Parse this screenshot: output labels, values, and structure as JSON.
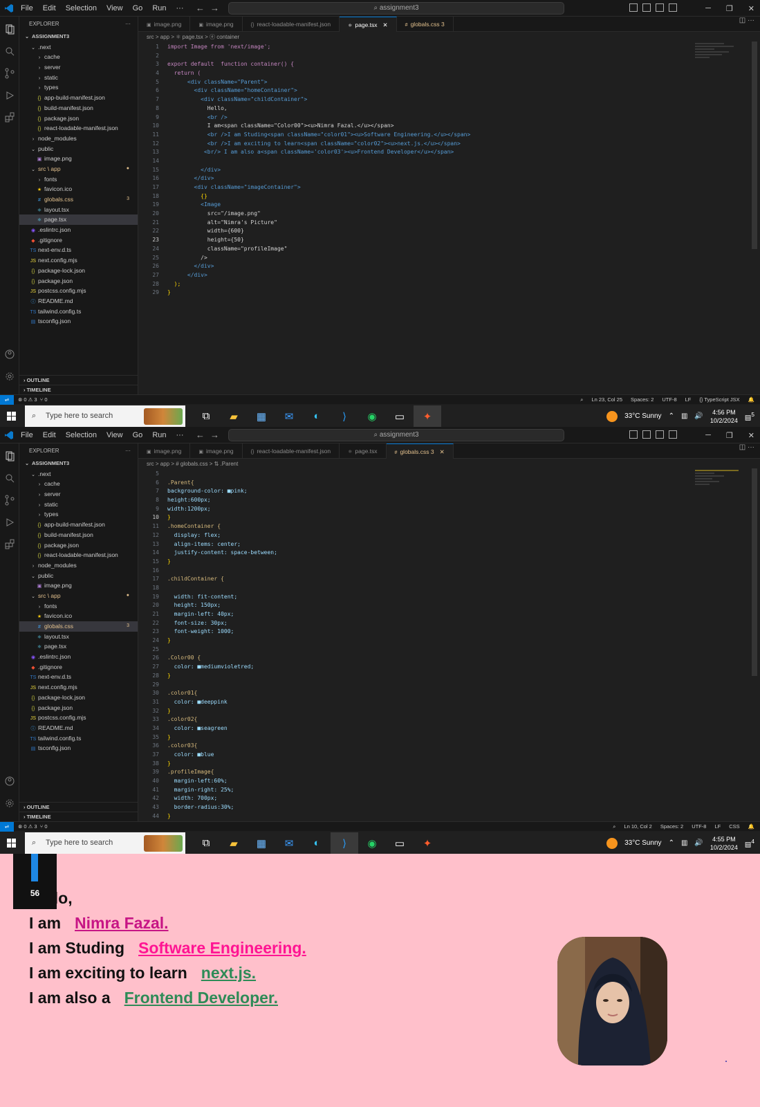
{
  "menu": [
    "File",
    "Edit",
    "Selection",
    "View",
    "Go",
    "Run",
    "···"
  ],
  "command_center": "assignment3",
  "explorer": {
    "title": "EXPLORER",
    "root": "ASSIGNMENT3",
    "items": [
      {
        "label": ".next",
        "glyph": "⌄",
        "depth": 1
      },
      {
        "label": "cache",
        "glyph": "›",
        "depth": 2
      },
      {
        "label": "server",
        "glyph": "›",
        "depth": 2
      },
      {
        "label": "static",
        "glyph": "›",
        "depth": 2
      },
      {
        "label": "types",
        "glyph": "›",
        "depth": 2
      },
      {
        "label": "app-build-manifest.json",
        "glyph": "{}",
        "depth": 2
      },
      {
        "label": "build-manifest.json",
        "glyph": "{}",
        "depth": 2
      },
      {
        "label": "package.json",
        "glyph": "{}",
        "depth": 2
      },
      {
        "label": "react-loadable-manifest.json",
        "glyph": "{}",
        "depth": 2
      },
      {
        "label": "node_modules",
        "glyph": "›",
        "depth": 1
      },
      {
        "label": "public",
        "glyph": "⌄",
        "depth": 1
      },
      {
        "label": "image.png",
        "glyph": "▣",
        "depth": 2
      },
      {
        "label": "src \\ app",
        "glyph": "⌄",
        "depth": 1
      },
      {
        "label": "fonts",
        "glyph": "›",
        "depth": 2
      },
      {
        "label": "favicon.ico",
        "glyph": "★",
        "depth": 2
      },
      {
        "label": "globals.css",
        "glyph": "#",
        "depth": 2
      },
      {
        "label": "layout.tsx",
        "glyph": "⚛",
        "depth": 2
      },
      {
        "label": "page.tsx",
        "glyph": "⚛",
        "depth": 2
      },
      {
        "label": ".eslintrc.json",
        "glyph": "◉",
        "depth": 1
      },
      {
        "label": ".gitignore",
        "glyph": "◆",
        "depth": 1
      },
      {
        "label": "next-env.d.ts",
        "glyph": "TS",
        "depth": 1
      },
      {
        "label": "next.config.mjs",
        "glyph": "JS",
        "depth": 1
      },
      {
        "label": "package-lock.json",
        "glyph": "{}",
        "depth": 1
      },
      {
        "label": "package.json",
        "glyph": "{}",
        "depth": 1
      },
      {
        "label": "postcss.config.mjs",
        "glyph": "JS",
        "depth": 1
      },
      {
        "label": "README.md",
        "glyph": "ⓘ",
        "depth": 1
      },
      {
        "label": "tailwind.config.ts",
        "glyph": "TS",
        "depth": 1
      },
      {
        "label": "tsconfig.json",
        "glyph": "▤",
        "depth": 1
      }
    ],
    "outline": "OUTLINE",
    "timeline": "TIMELINE"
  },
  "tabs": [
    "image.png",
    "image.png",
    "react-loadable-manifest.json",
    "page.tsx",
    "globals.css 3"
  ],
  "top": {
    "breadcrumb": "src > app > ⚛ page.tsx > ⓔ container",
    "cursor": "Ln 23, Col 25",
    "lang": "TypeScript JSX",
    "time": "4:56 PM",
    "date": "10/2/2024",
    "notif": "5",
    "code": [
      "import Image from 'next/image';",
      "",
      "export default  function container() {",
      "  return (",
      "      <div className=\"Parent\">",
      "        <div className=\"homeContainer\">",
      "          <div className=\"childContainer\">",
      "            Hello,",
      "            <br />",
      "            I am<span className=\"Color00\"><u>Nimra Fazal.</u></span>",
      "            <br />I am Studing<span className=\"color01\"><u>Software Engineering.</u></span>",
      "            <br />I am exciting to learn<span className=\"color02\"><u>next.js.</u></span>",
      "           <br/> I am also a<span className='color03'><u>Frontend Developer</u></span>",
      "",
      "          </div>",
      "        </div>",
      "        <div className=\"imageContainer\">",
      "          {}",
      "          <Image",
      "            src=\"/image.png\"",
      "            alt=\"Nimra's Picture\"",
      "            width={600}",
      "            height={50}",
      "            className=\"profileImage\"",
      "          />",
      "        </div>",
      "      </div>",
      "  );",
      "}"
    ]
  },
  "bottom": {
    "breadcrumb": "src > app > # globals.css > ⇅ .Parent",
    "cursor": "Ln 10, Col 2",
    "lang": "CSS",
    "time": "4:55 PM",
    "date": "10/2/2024",
    "notif": "4",
    "code": [
      "",
      ".Parent{",
      "background-color: ■pink;",
      "height:600px;",
      "width:1200px;",
      "}",
      ".homeContainer {",
      "  display: flex;",
      "  align-items: center;",
      "  justify-content: space-between;",
      "}",
      "",
      ".childContainer {",
      "",
      "  width: fit-content;",
      "  height: 150px;",
      "  margin-left: 40px;",
      "  font-size: 30px;",
      "  font-weight: 1000;",
      "}",
      "",
      ".Color00 {",
      "  color: ■mediumvioletred;",
      "}",
      "",
      ".color01{",
      "  color: ■deeppink",
      "}",
      ".color02{",
      "  color: ■seagreen",
      "}",
      ".color03{",
      "  color: ■blue",
      "}",
      ".profileImage{",
      "  margin-left:60%;",
      "  margin-right: 25%;",
      "  width: 700px;",
      "  border-radius:30%;",
      "}"
    ]
  },
  "status": {
    "errors": "⊗ 0 ⚠ 3",
    "ports": "⑂ 0",
    "spaces": "Spaces: 2",
    "encoding": "UTF-8",
    "eol": "LF"
  },
  "taskbar": {
    "search_placeholder": "Type here to search",
    "weather": "33°C  Sunny"
  },
  "preview": {
    "counter": "56",
    "lines": [
      {
        "prefix": "Hello,",
        "highlight": "",
        "color": ""
      },
      {
        "prefix": "I am",
        "highlight": "Nimra Fazal.",
        "color": "#c71585"
      },
      {
        "prefix": "I am Studing",
        "highlight": "Software Engineering.",
        "color": "#ff1493"
      },
      {
        "prefix": "I am exciting to learn",
        "highlight": "next.js.",
        "color": "#2e8b57"
      },
      {
        "prefix": "I am also a",
        "highlight": "Frontend Developer.",
        "color": "#2e8b57"
      }
    ]
  }
}
